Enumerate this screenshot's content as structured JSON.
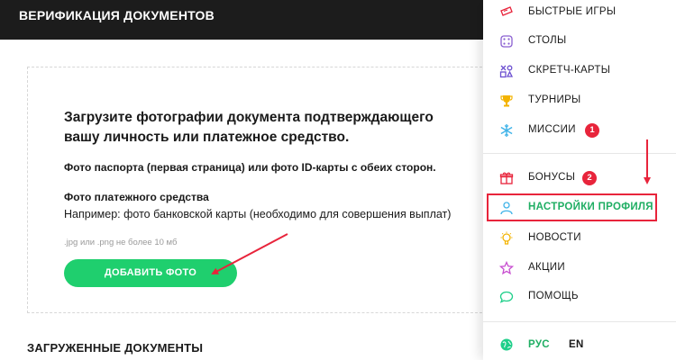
{
  "header": {
    "title": "ВЕРИФИКАЦИЯ ДОКУМЕНТОВ"
  },
  "upload": {
    "heading": "Загрузите фотографии документа подтверждающего вашу личность или платежное средство.",
    "passport_text": "Фото паспорта (первая страница) или фото ID-карты с обеих сторон.",
    "payment_title": "Фото платежного средства",
    "payment_example": "Например: фото банковской карты (необходимо для совершения выплат)",
    "file_hint": ".jpg или .png не более 10 мб",
    "add_button_label": "ДОБАВИТЬ ФОТО"
  },
  "uploaded_docs_title": "ЗАГРУЖЕННЫЕ ДОКУМЕНТЫ",
  "menu": {
    "items": [
      {
        "label": "БЫСТРЫЕ ИГРЫ",
        "icon": "ticket-icon"
      },
      {
        "label": "СТОЛЫ",
        "icon": "dice-icon"
      },
      {
        "label": "СКРЕТЧ-КАРТЫ",
        "icon": "scratch-card-icon"
      },
      {
        "label": "ТУРНИРЫ",
        "icon": "trophy-icon"
      },
      {
        "label": "МИССИИ",
        "icon": "snowflake-icon",
        "badge": "1"
      },
      {
        "label": "БОНУСЫ",
        "icon": "gift-icon",
        "badge": "2"
      },
      {
        "label": "НАСТРОЙКИ ПРОФИЛЯ",
        "icon": "user-icon",
        "active": true
      },
      {
        "label": "НОВОСТИ",
        "icon": "lightbulb-icon"
      },
      {
        "label": "АКЦИИ",
        "icon": "star-icon"
      },
      {
        "label": "ПОМОЩЬ",
        "icon": "chat-bubble-icon"
      }
    ],
    "languages": {
      "ru": "РУС",
      "en": "EN"
    }
  },
  "colors": {
    "accent_green": "#1fcf6e",
    "active_text": "#1fae63",
    "badge_red": "#e8243b",
    "header_bg": "#1c1c1c"
  }
}
